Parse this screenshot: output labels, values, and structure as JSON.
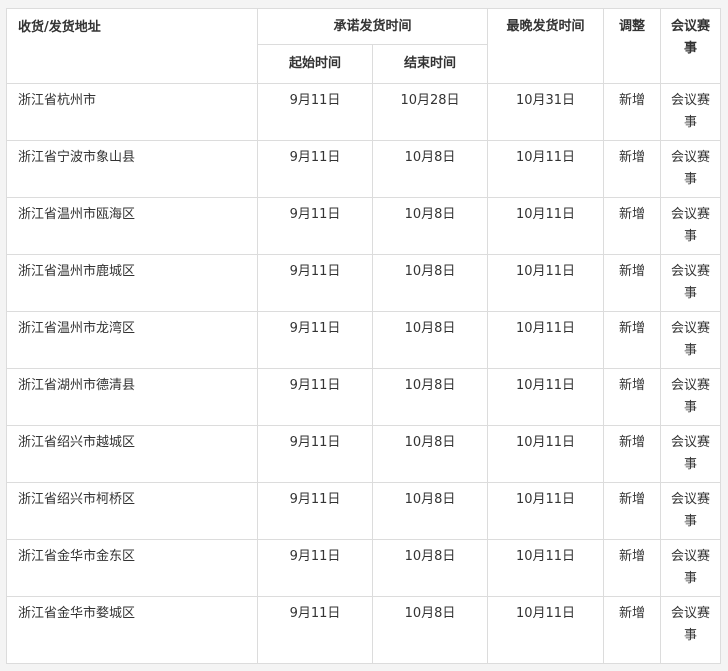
{
  "header": {
    "address": "收货/发货地址",
    "promised": "承诺发货时间",
    "start": "起始时间",
    "end": "结束时间",
    "latest": "最晚发货时间",
    "adjust": "调整",
    "note": "会议赛事"
  },
  "rows": [
    {
      "address": "浙江省杭州市",
      "start": "9月11日",
      "end": "10月28日",
      "latest": "10月31日",
      "adjust": "新增",
      "note": "会议赛事"
    },
    {
      "address": "浙江省宁波市象山县",
      "start": "9月11日",
      "end": "10月8日",
      "latest": "10月11日",
      "adjust": "新增",
      "note": "会议赛事"
    },
    {
      "address": "浙江省温州市瓯海区",
      "start": "9月11日",
      "end": "10月8日",
      "latest": "10月11日",
      "adjust": "新增",
      "note": "会议赛事"
    },
    {
      "address": "浙江省温州市鹿城区",
      "start": "9月11日",
      "end": "10月8日",
      "latest": "10月11日",
      "adjust": "新增",
      "note": "会议赛事"
    },
    {
      "address": "浙江省温州市龙湾区",
      "start": "9月11日",
      "end": "10月8日",
      "latest": "10月11日",
      "adjust": "新增",
      "note": "会议赛事"
    },
    {
      "address": "浙江省湖州市德清县",
      "start": "9月11日",
      "end": "10月8日",
      "latest": "10月11日",
      "adjust": "新增",
      "note": "会议赛事"
    },
    {
      "address": "浙江省绍兴市越城区",
      "start": "9月11日",
      "end": "10月8日",
      "latest": "10月11日",
      "adjust": "新增",
      "note": "会议赛事"
    },
    {
      "address": "浙江省绍兴市柯桥区",
      "start": "9月11日",
      "end": "10月8日",
      "latest": "10月11日",
      "adjust": "新增",
      "note": "会议赛事"
    },
    {
      "address": "浙江省金华市金东区",
      "start": "9月11日",
      "end": "10月8日",
      "latest": "10月11日",
      "adjust": "新增",
      "note": "会议赛事"
    },
    {
      "address": "浙江省金华市婺城区",
      "start": "9月11日",
      "end": "10月8日",
      "latest": "10月11日",
      "adjust": "新增",
      "note": "会议赛事"
    }
  ]
}
